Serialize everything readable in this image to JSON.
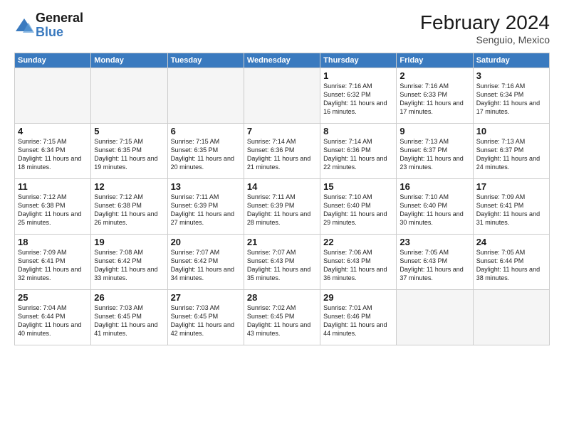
{
  "header": {
    "title": "February 2024",
    "location": "Senguio, Mexico",
    "logo_general": "General",
    "logo_blue": "Blue"
  },
  "days_of_week": [
    "Sunday",
    "Monday",
    "Tuesday",
    "Wednesday",
    "Thursday",
    "Friday",
    "Saturday"
  ],
  "weeks": [
    [
      {
        "day": "",
        "empty": true
      },
      {
        "day": "",
        "empty": true
      },
      {
        "day": "",
        "empty": true
      },
      {
        "day": "",
        "empty": true
      },
      {
        "day": "1",
        "sunrise": "7:16 AM",
        "sunset": "6:32 PM",
        "daylight": "11 hours and 16 minutes."
      },
      {
        "day": "2",
        "sunrise": "7:16 AM",
        "sunset": "6:33 PM",
        "daylight": "11 hours and 17 minutes."
      },
      {
        "day": "3",
        "sunrise": "7:16 AM",
        "sunset": "6:34 PM",
        "daylight": "11 hours and 17 minutes."
      }
    ],
    [
      {
        "day": "4",
        "sunrise": "7:15 AM",
        "sunset": "6:34 PM",
        "daylight": "11 hours and 18 minutes."
      },
      {
        "day": "5",
        "sunrise": "7:15 AM",
        "sunset": "6:35 PM",
        "daylight": "11 hours and 19 minutes."
      },
      {
        "day": "6",
        "sunrise": "7:15 AM",
        "sunset": "6:35 PM",
        "daylight": "11 hours and 20 minutes."
      },
      {
        "day": "7",
        "sunrise": "7:14 AM",
        "sunset": "6:36 PM",
        "daylight": "11 hours and 21 minutes."
      },
      {
        "day": "8",
        "sunrise": "7:14 AM",
        "sunset": "6:36 PM",
        "daylight": "11 hours and 22 minutes."
      },
      {
        "day": "9",
        "sunrise": "7:13 AM",
        "sunset": "6:37 PM",
        "daylight": "11 hours and 23 minutes."
      },
      {
        "day": "10",
        "sunrise": "7:13 AM",
        "sunset": "6:37 PM",
        "daylight": "11 hours and 24 minutes."
      }
    ],
    [
      {
        "day": "11",
        "sunrise": "7:12 AM",
        "sunset": "6:38 PM",
        "daylight": "11 hours and 25 minutes."
      },
      {
        "day": "12",
        "sunrise": "7:12 AM",
        "sunset": "6:38 PM",
        "daylight": "11 hours and 26 minutes."
      },
      {
        "day": "13",
        "sunrise": "7:11 AM",
        "sunset": "6:39 PM",
        "daylight": "11 hours and 27 minutes."
      },
      {
        "day": "14",
        "sunrise": "7:11 AM",
        "sunset": "6:39 PM",
        "daylight": "11 hours and 28 minutes."
      },
      {
        "day": "15",
        "sunrise": "7:10 AM",
        "sunset": "6:40 PM",
        "daylight": "11 hours and 29 minutes."
      },
      {
        "day": "16",
        "sunrise": "7:10 AM",
        "sunset": "6:40 PM",
        "daylight": "11 hours and 30 minutes."
      },
      {
        "day": "17",
        "sunrise": "7:09 AM",
        "sunset": "6:41 PM",
        "daylight": "11 hours and 31 minutes."
      }
    ],
    [
      {
        "day": "18",
        "sunrise": "7:09 AM",
        "sunset": "6:41 PM",
        "daylight": "11 hours and 32 minutes."
      },
      {
        "day": "19",
        "sunrise": "7:08 AM",
        "sunset": "6:42 PM",
        "daylight": "11 hours and 33 minutes."
      },
      {
        "day": "20",
        "sunrise": "7:07 AM",
        "sunset": "6:42 PM",
        "daylight": "11 hours and 34 minutes."
      },
      {
        "day": "21",
        "sunrise": "7:07 AM",
        "sunset": "6:43 PM",
        "daylight": "11 hours and 35 minutes."
      },
      {
        "day": "22",
        "sunrise": "7:06 AM",
        "sunset": "6:43 PM",
        "daylight": "11 hours and 36 minutes."
      },
      {
        "day": "23",
        "sunrise": "7:05 AM",
        "sunset": "6:43 PM",
        "daylight": "11 hours and 37 minutes."
      },
      {
        "day": "24",
        "sunrise": "7:05 AM",
        "sunset": "6:44 PM",
        "daylight": "11 hours and 38 minutes."
      }
    ],
    [
      {
        "day": "25",
        "sunrise": "7:04 AM",
        "sunset": "6:44 PM",
        "daylight": "11 hours and 40 minutes."
      },
      {
        "day": "26",
        "sunrise": "7:03 AM",
        "sunset": "6:45 PM",
        "daylight": "11 hours and 41 minutes."
      },
      {
        "day": "27",
        "sunrise": "7:03 AM",
        "sunset": "6:45 PM",
        "daylight": "11 hours and 42 minutes."
      },
      {
        "day": "28",
        "sunrise": "7:02 AM",
        "sunset": "6:45 PM",
        "daylight": "11 hours and 43 minutes."
      },
      {
        "day": "29",
        "sunrise": "7:01 AM",
        "sunset": "6:46 PM",
        "daylight": "11 hours and 44 minutes."
      },
      {
        "day": "",
        "empty": true
      },
      {
        "day": "",
        "empty": true
      }
    ]
  ]
}
